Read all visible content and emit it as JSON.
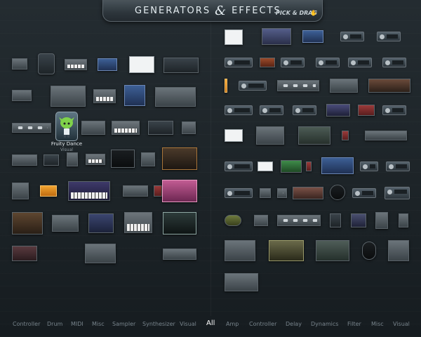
{
  "header": {
    "title_left": "GENERATORS",
    "title_amp": "&",
    "title_right": "EFFECTS",
    "pick_drag": "PICK & DRAG"
  },
  "selected_plugin": {
    "name": "Fruity Dance",
    "category": "Visual"
  },
  "categories": [
    {
      "label": "Controller",
      "side": "generators",
      "active": false
    },
    {
      "label": "Drum",
      "side": "generators",
      "active": false
    },
    {
      "label": "MIDI",
      "side": "generators",
      "active": false
    },
    {
      "label": "Misc",
      "side": "generators",
      "active": false
    },
    {
      "label": "Sampler",
      "side": "generators",
      "active": false
    },
    {
      "label": "Synthesizer",
      "side": "generators",
      "active": false
    },
    {
      "label": "Visual",
      "side": "generators",
      "active": false
    },
    {
      "label": "All",
      "side": "both",
      "active": true
    },
    {
      "label": "Amp",
      "side": "effects",
      "active": false
    },
    {
      "label": "Controller",
      "side": "effects",
      "active": false
    },
    {
      "label": "Delay",
      "side": "effects",
      "active": false
    },
    {
      "label": "Dynamics",
      "side": "effects",
      "active": false
    },
    {
      "label": "Filter",
      "side": "effects",
      "active": false
    },
    {
      "label": "Misc",
      "side": "effects",
      "active": false
    },
    {
      "label": "Visual",
      "side": "effects",
      "active": false
    }
  ],
  "colors": {
    "background": "#1f262b",
    "active_category": "#ffffff",
    "inactive_category": "#77838b"
  }
}
